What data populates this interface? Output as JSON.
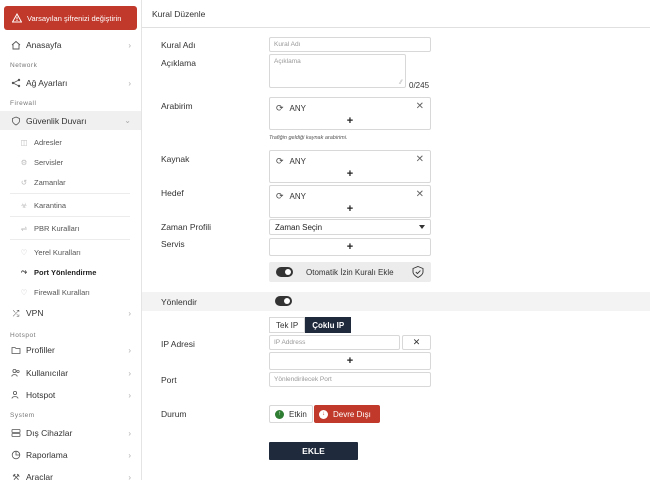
{
  "sidebar": {
    "alert_label": "Varsayılan şifrenizi değiştirin",
    "home": "Anasayfa",
    "section_network": "Network",
    "network_settings": "Ağ Ayarları",
    "section_firewall": "Firewall",
    "firewall": "Güvenlik Duvarı",
    "fw_items": [
      "Adresler",
      "Servisler",
      "Zamanlar",
      "Karantina",
      "PBR Kuralları",
      "Yerel Kuralları",
      "Port Yönlendirme",
      "Firewall Kuralları"
    ],
    "vpn": "VPN",
    "section_hotspot": "Hotspot",
    "profiles": "Profiller",
    "users": "Kullanıcılar",
    "hotspot": "Hotspot",
    "section_system": "System",
    "external_devices": "Dış Cihazlar",
    "reporting": "Raporlama",
    "tools": "Araçlar"
  },
  "main": {
    "page_title": "Kural Düzenle",
    "rule_name_label": "Kural Adı",
    "rule_name_placeholder": "Kural Adı",
    "description_label": "Açıklama",
    "description_placeholder": "Açıklama",
    "char_counter": "0/245",
    "interface_label": "Arabirim",
    "interface_value": "ANY",
    "interface_hint": "Trafiğin geldiği kaynak arabirimi.",
    "source_label": "Kaynak",
    "source_value": "ANY",
    "destination_label": "Hedef",
    "destination_value": "ANY",
    "time_profile_label": "Zaman Profili",
    "time_profile_value": "Zaman Seçin",
    "service_label": "Servis",
    "auto_rule_label": "Otomatik İzin Kuralı Ekle",
    "redirect_label": "Yönlendir",
    "single_ip": "Tek IP",
    "multi_ip": "Çoklu IP",
    "ip_label": "IP Adresi",
    "ip_placeholder": "IP Address",
    "port_label": "Port",
    "port_placeholder": "Yönlendirilecek Port",
    "status_label": "Durum",
    "status_enabled": "Etkin",
    "status_disabled": "Devre Dışı",
    "submit_label": "EKLE"
  },
  "colors": {
    "accent_red": "#c0392b",
    "dark_navy": "#1f2a3c",
    "enabled_green": "#2e7d32"
  }
}
